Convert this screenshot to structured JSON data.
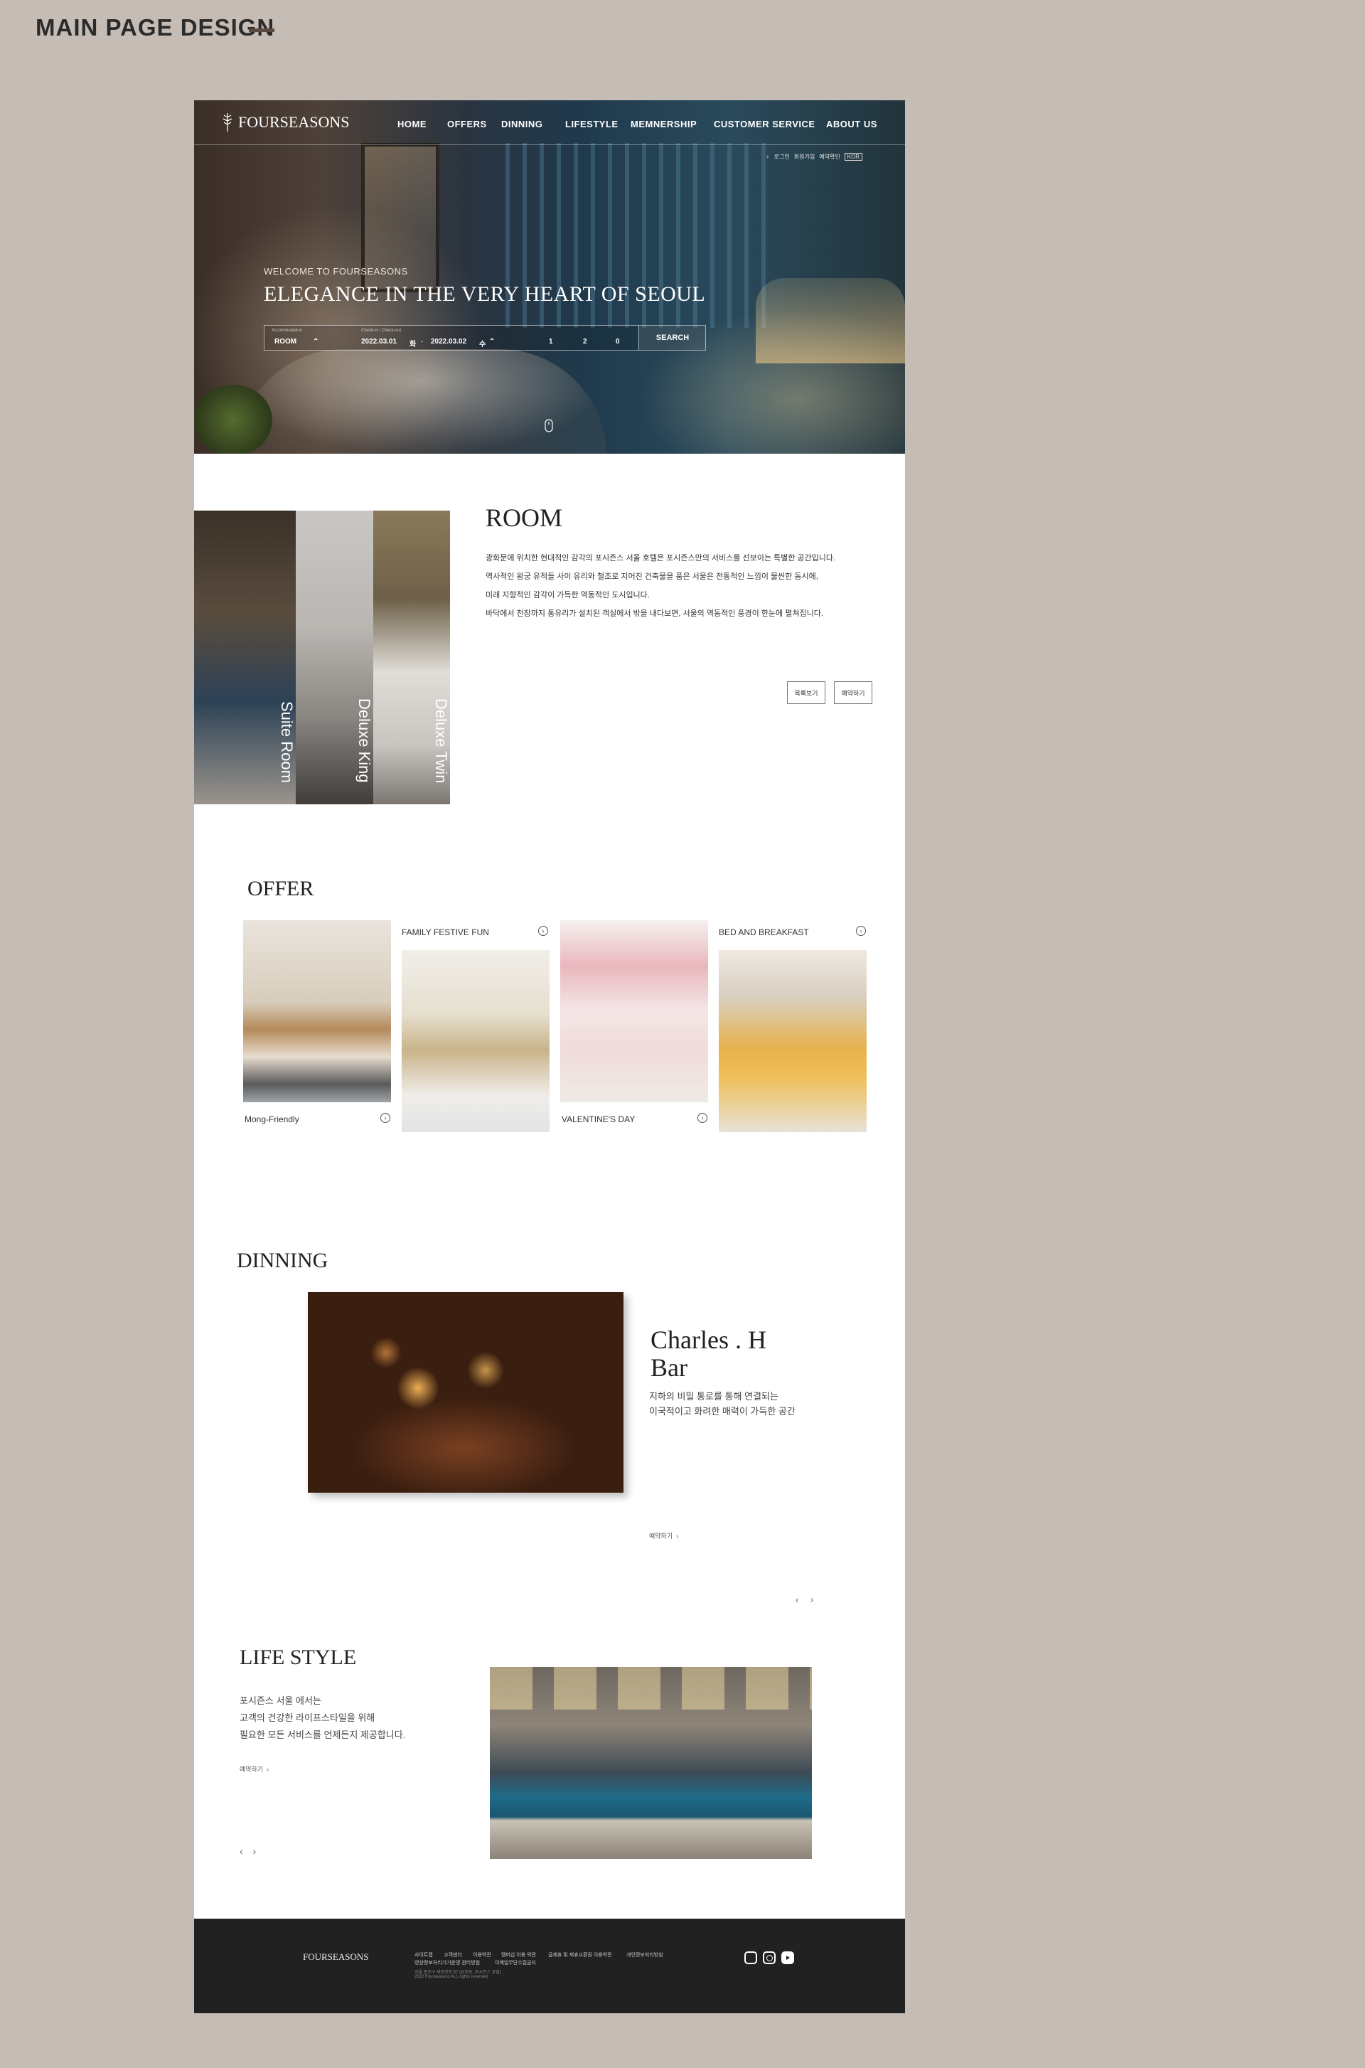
{
  "board": {
    "title": "MAIN PAGE DESIGN"
  },
  "nav": {
    "logo": "FOURSEASONS",
    "items": [
      "HOME",
      "OFFERS",
      "DINNING",
      "LIFESTYLE",
      "MEMNERSHIP",
      "CUSTOMER SERVICE",
      "ABOUT US"
    ],
    "utility": [
      "로그인",
      "회원가입",
      "예약확인"
    ],
    "language": "KOR"
  },
  "hero": {
    "welcome": "WELCOME TO FOURSEASONS",
    "title": "ELEGANCE IN THE VERY HEART OF SEOUL",
    "booking": {
      "type_label": "Accommodation",
      "type": "ROOM",
      "dates_label": "Check-in / Check-out",
      "checkin": "2022.03.01",
      "checkin_day": "화",
      "separator": "-",
      "checkout": "2022.03.02",
      "checkout_day": "수",
      "rooms": "1",
      "adults": "2",
      "children": "0",
      "search": "SEARCH"
    }
  },
  "room": {
    "title": "ROOM",
    "strips": [
      "Suite Room",
      "Deluxe King",
      "Deluxe Twin"
    ],
    "description": [
      "광화문에 위치한 현대적인 감각의 포시즌스 서울 호텔은 포시즌스만의 서비스를 선보이는 특별한 공간입니다.",
      "역사적인 왕궁 유적들 사이 유리와 철조로 지어진 건축물을 품은 서울은 전통적인 느낌이 물씬한 동시에,",
      "미래 지향적인 감각이 가득한 역동적인 도시입니다.",
      "바닥에서 천장까지 통유리가 설치된 객실에서 밖을 내다보면, 서울의 역동적인 풍경이 한눈에 펼쳐집니다."
    ],
    "buttons": [
      "목록보기",
      "예약하기"
    ]
  },
  "offer": {
    "title": "OFFER",
    "cards": [
      "Mong-Friendly",
      "FAMILY FESTIVE FUN",
      "VALENTINE'S DAY",
      "BED AND BREAKFAST"
    ]
  },
  "dinning": {
    "title": "DINNING",
    "name_line1": "Charles . H",
    "name_line2": "Bar",
    "desc": [
      "지하의 비밀 통로를 통해 연결되는",
      "이국적이고 화려한 매력이 가득한 공간"
    ],
    "link": "예약하기",
    "prev": "‹",
    "next": "›"
  },
  "lifestyle": {
    "title": "LIFE STYLE",
    "desc": [
      "포시즌스 서울 에서는",
      "고객의 건강한 라이프스타일을 위해",
      "필요한 모든 서비스를 언제든지 제공합니다."
    ],
    "link": "예약하기",
    "prev": "‹",
    "next": "›"
  },
  "footer": {
    "logo": "FOURSEASONS",
    "links_row1": [
      "사이트맵",
      "고객센터",
      "이용약관",
      "멤버십 이용 약관",
      "급제휴 및 제휴교환권 이용약관",
      "개인정보처리방침"
    ],
    "links_row2": [
      "영상정보처리기기운영 관리방침",
      "이메일무단수집금지"
    ],
    "address": "서울 종로구 새문안로 97 (당주동, 포시즌스 호텔)",
    "copyright": "2022 Fourseasons ALL rights reserved.",
    "social": [
      "kakao-icon",
      "instagram-icon",
      "youtube-icon"
    ]
  }
}
